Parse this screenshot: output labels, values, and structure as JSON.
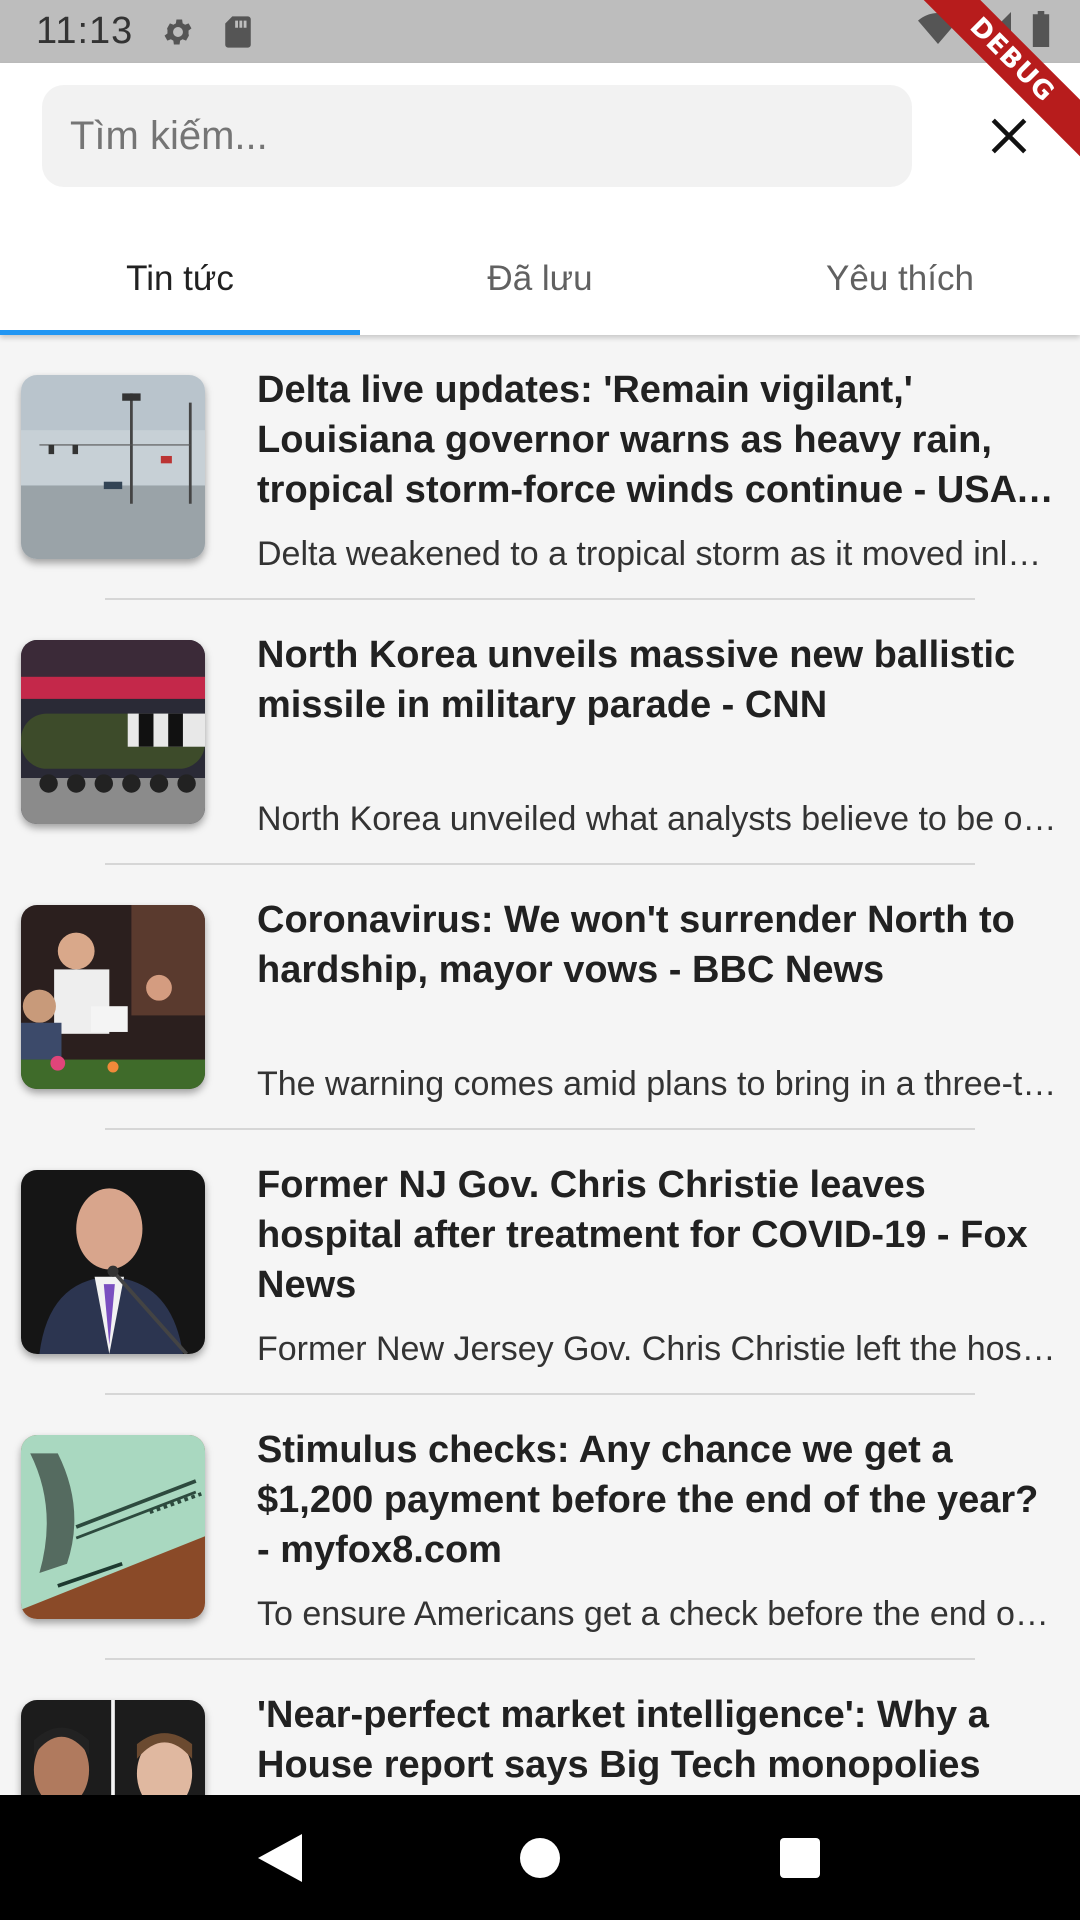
{
  "status_bar": {
    "time": "11:13",
    "icons": [
      "gear-icon",
      "sd-card-icon",
      "wifi-icon",
      "signal-icon",
      "battery-icon"
    ]
  },
  "debug_banner": "DEBUG",
  "search": {
    "placeholder": "Tìm kiếm...",
    "value": ""
  },
  "tabs": [
    {
      "label": "Tin tức",
      "active": true
    },
    {
      "label": "Đã lưu",
      "active": false
    },
    {
      "label": "Yêu thích",
      "active": false
    }
  ],
  "colors": {
    "accent": "#2196f3",
    "status_bar": "#bdbdbd",
    "debug": "#b71c1c"
  },
  "news": [
    {
      "title": "Delta live updates: 'Remain vigilant,' Louisiana governor warns as heavy rain, tropical storm-force winds continue - USA TODAY",
      "description": "Delta weakened to a tropical storm as it moved inland",
      "thumbnail": "storm-street-photo"
    },
    {
      "title": "North Korea unveils massive new ballistic missile in military parade - CNN",
      "description": "North Korea unveiled what analysts believe to be one of the largest",
      "thumbnail": "missile-parade-photo"
    },
    {
      "title": "Coronavirus: We won't surrender North to hardship, mayor vows - BBC News",
      "description": "The warning comes amid plans to bring in a three-tier system",
      "thumbnail": "bar-service-photo"
    },
    {
      "title": "Former NJ Gov. Chris Christie leaves hospital after treatment for COVID-19 - Fox News",
      "description": "Former New Jersey Gov. Chris Christie left the hospital",
      "thumbnail": "speaker-portrait-photo"
    },
    {
      "title": "Stimulus checks: Any chance we get a $1,200 payment before the end of the year? - myfox8.com",
      "description": "To ensure Americans get a check before the end of the year",
      "thumbnail": "stimulus-check-photo"
    },
    {
      "title": "'Near-perfect market intelligence': Why a House report says Big Tech monopolies",
      "description": "",
      "thumbnail": "tech-ceos-photo"
    }
  ],
  "nav": [
    "back-icon",
    "home-icon",
    "recents-icon"
  ]
}
